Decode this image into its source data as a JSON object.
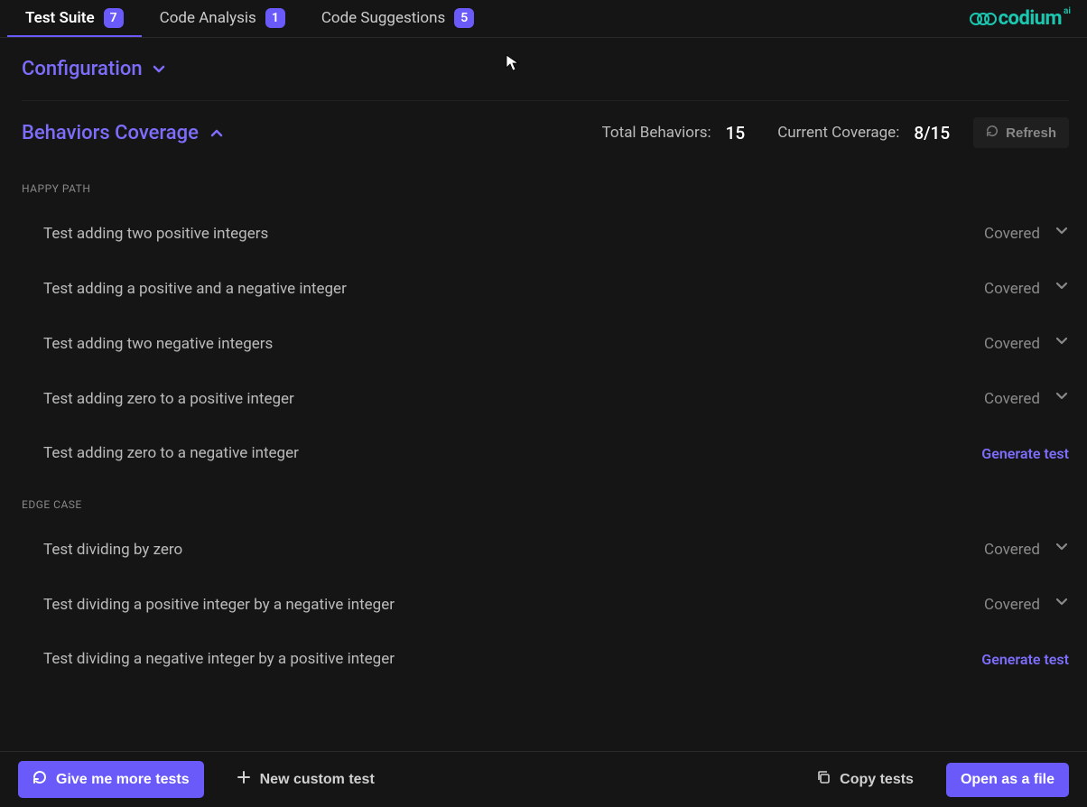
{
  "tabs": [
    {
      "label": "Test Suite",
      "badge": "7",
      "active": true
    },
    {
      "label": "Code Analysis",
      "badge": "1",
      "active": false
    },
    {
      "label": "Code Suggestions",
      "badge": "5",
      "active": false
    }
  ],
  "logo": {
    "text": "codium",
    "suffix": "ai"
  },
  "configuration": {
    "title": "Configuration"
  },
  "behaviors": {
    "title": "Behaviors Coverage",
    "total_label": "Total Behaviors:",
    "total_value": "15",
    "coverage_label": "Current Coverage:",
    "coverage_value": "8/15",
    "refresh_label": "Refresh"
  },
  "sections": [
    {
      "heading": "HAPPY PATH",
      "items": [
        {
          "name": "Test adding two positive integers",
          "status": "covered"
        },
        {
          "name": "Test adding a positive and a negative integer",
          "status": "covered"
        },
        {
          "name": "Test adding two negative integers",
          "status": "covered"
        },
        {
          "name": "Test adding zero to a positive integer",
          "status": "covered"
        },
        {
          "name": "Test adding zero to a negative integer",
          "status": "generate"
        }
      ]
    },
    {
      "heading": "EDGE CASE",
      "items": [
        {
          "name": "Test dividing by zero",
          "status": "covered"
        },
        {
          "name": "Test dividing a positive integer by a negative integer",
          "status": "covered"
        },
        {
          "name": "Test dividing a negative integer by a positive integer",
          "status": "generate"
        }
      ]
    }
  ],
  "status_labels": {
    "covered": "Covered",
    "generate": "Generate test"
  },
  "footer": {
    "more_tests": "Give me more tests",
    "new_custom": "New custom test",
    "copy": "Copy tests",
    "open_file": "Open as a file"
  }
}
